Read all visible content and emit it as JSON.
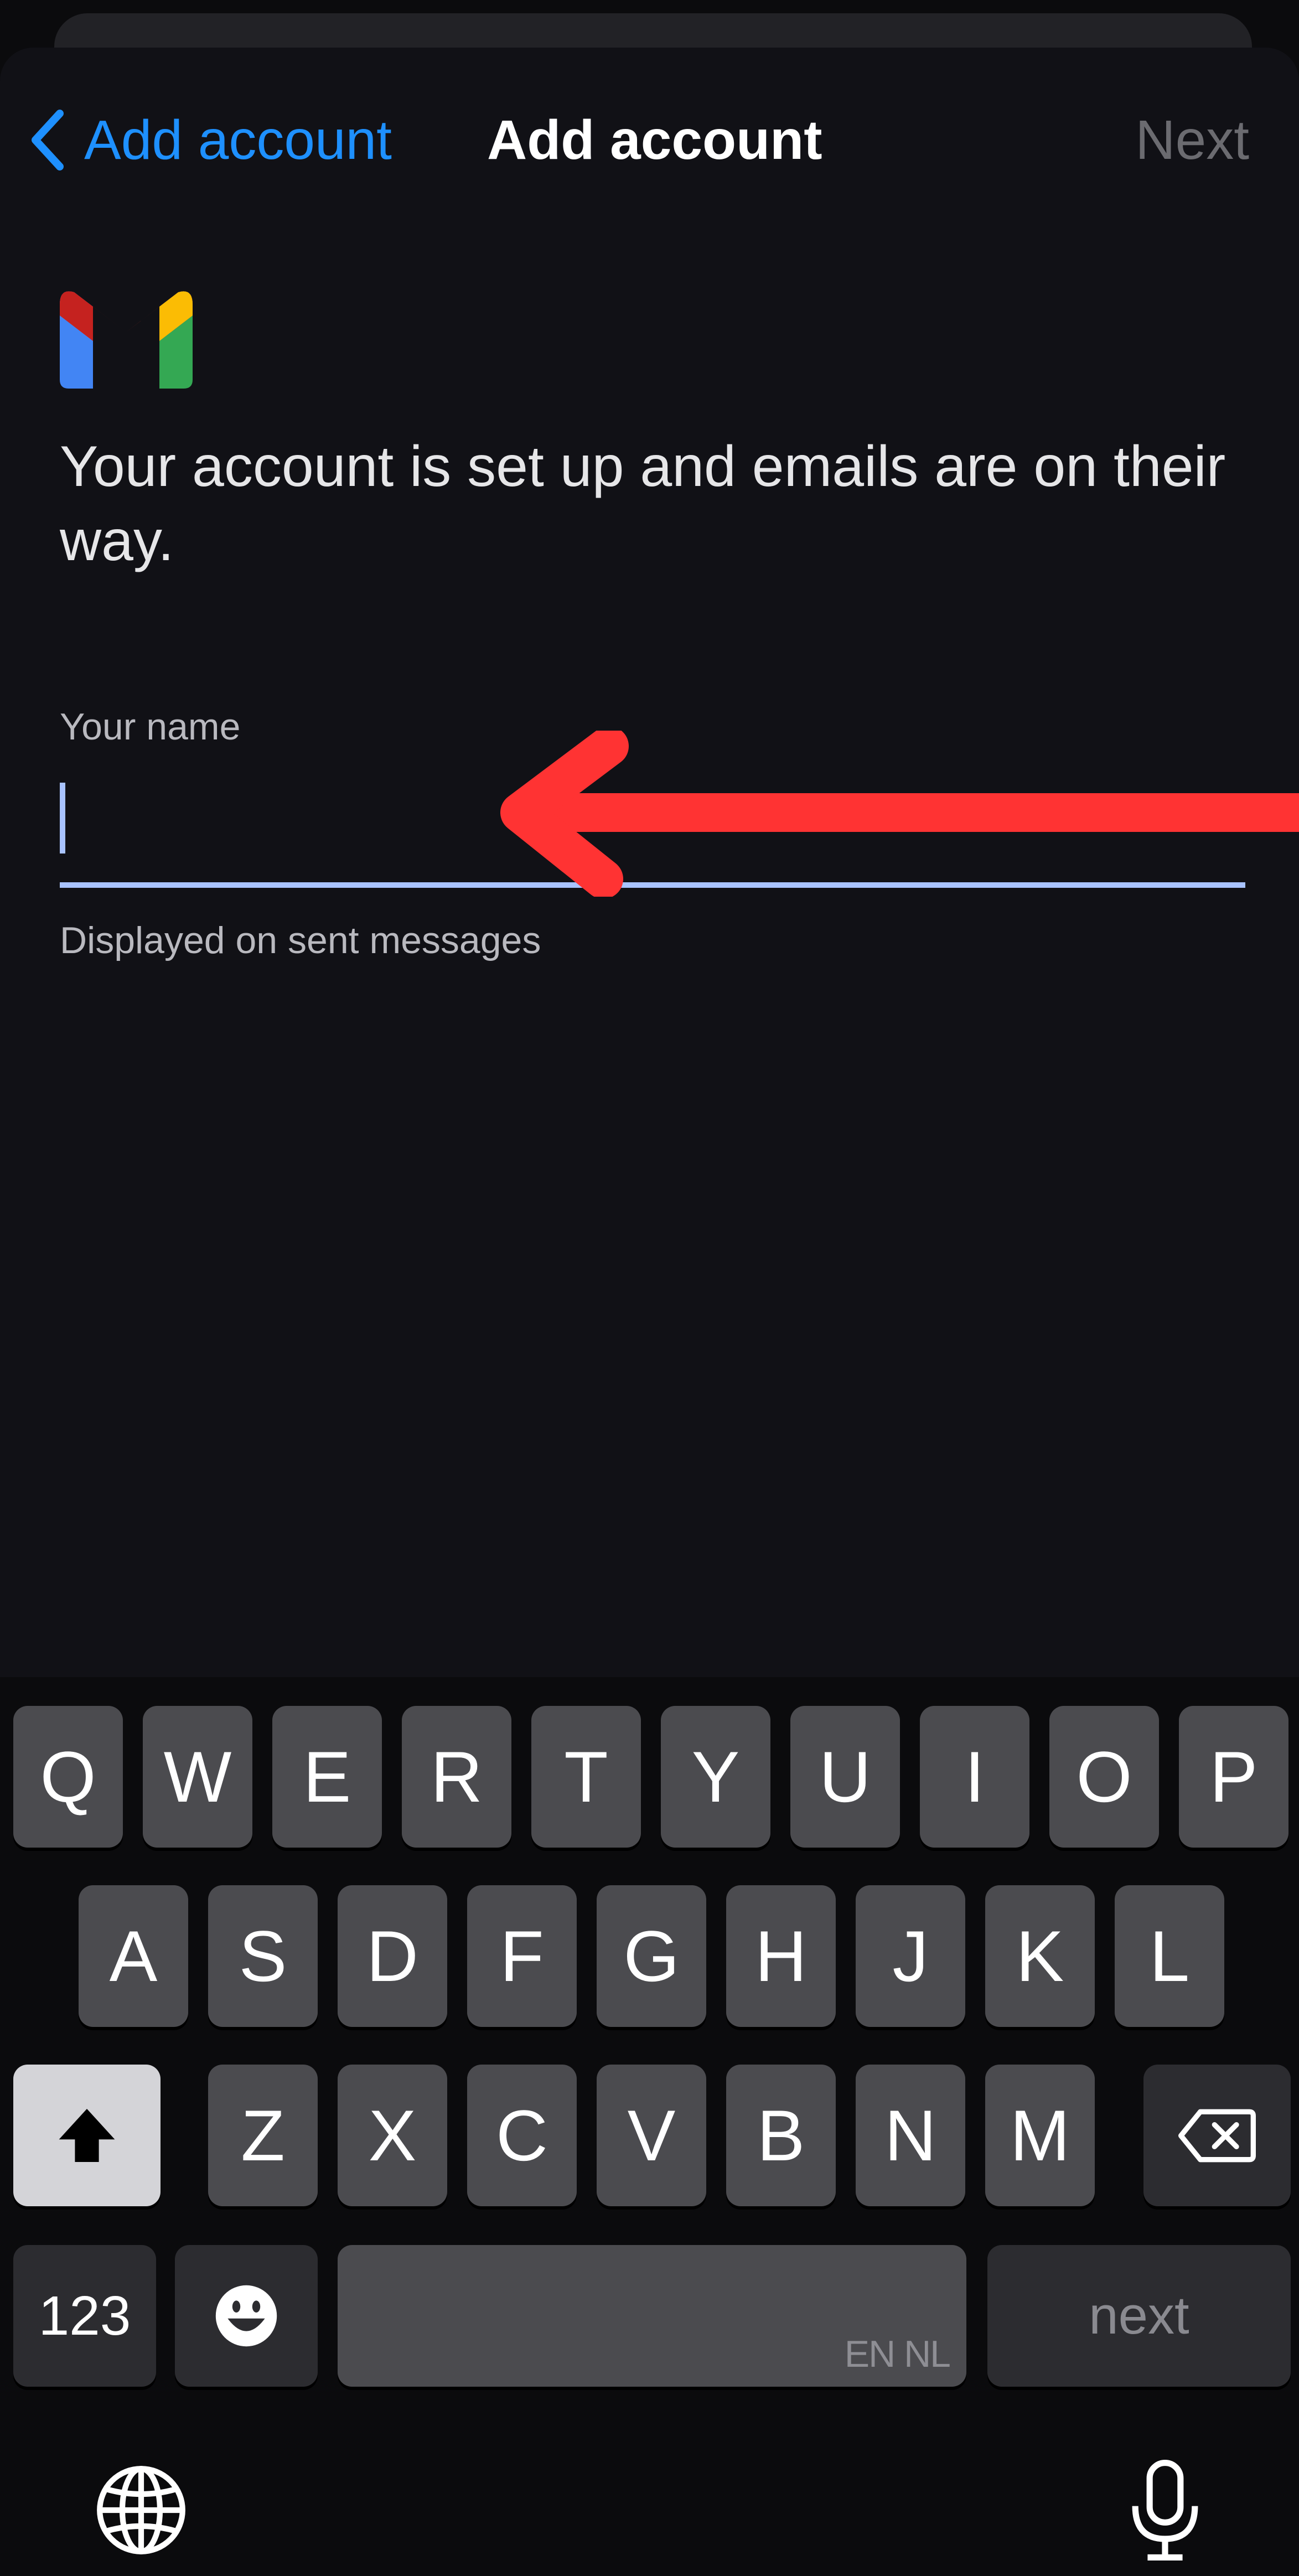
{
  "nav": {
    "back_label": "Add account",
    "title": "Add account",
    "next_label": "Next"
  },
  "content": {
    "logo_icon": "gmail-logo-icon",
    "headline": "Your account is set up and emails are on their way.",
    "field_label": "Your name",
    "field_value": "",
    "helper_text": "Displayed on sent messages"
  },
  "keyboard": {
    "row1": [
      "Q",
      "W",
      "E",
      "R",
      "T",
      "Y",
      "U",
      "I",
      "O",
      "P"
    ],
    "row2": [
      "A",
      "S",
      "D",
      "F",
      "G",
      "H",
      "J",
      "K",
      "L"
    ],
    "row3": [
      "Z",
      "X",
      "C",
      "V",
      "B",
      "N",
      "M"
    ],
    "numbers_label": "123",
    "space_lang": "EN NL",
    "return_label": "next"
  },
  "colors": {
    "accent": "#1e90ff",
    "field_underline": "#a9c3ff",
    "annotation_arrow": "#ff3333"
  }
}
